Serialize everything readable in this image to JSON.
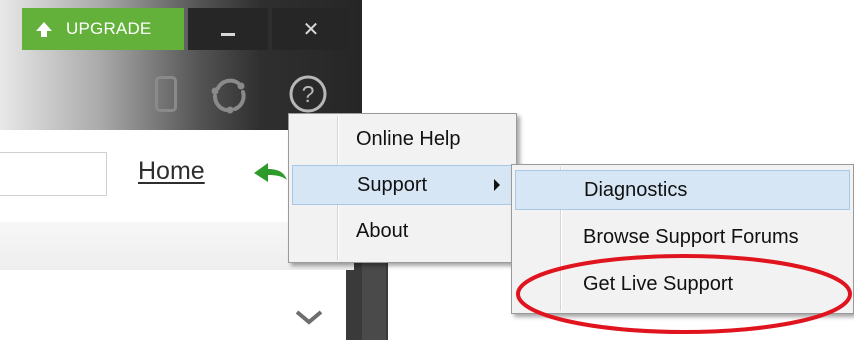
{
  "titlebar": {
    "upgrade_label": "UPGRADE",
    "close_label": "✕"
  },
  "toolbar": {
    "icons": [
      "phone-icon",
      "sync-icon",
      "help-icon"
    ],
    "help_glyph": "?"
  },
  "nav": {
    "home_label": "Home"
  },
  "help_menu": {
    "items": [
      {
        "label": "Online Help",
        "highlighted": false
      },
      {
        "label": "Support",
        "highlighted": true,
        "has_submenu": true
      },
      {
        "label": "About",
        "highlighted": false
      }
    ]
  },
  "support_submenu": {
    "items": [
      {
        "label": "Diagnostics",
        "highlighted": true
      },
      {
        "label": "Browse Support Forums",
        "highlighted": false
      },
      {
        "label": "Get Live Support",
        "highlighted": false,
        "annotated": true
      }
    ]
  },
  "colors": {
    "upgrade": "#63b13a",
    "arrow_green": "#2e9a2a",
    "highlight": "#d6e6f5",
    "annotation": "#e0141e"
  }
}
